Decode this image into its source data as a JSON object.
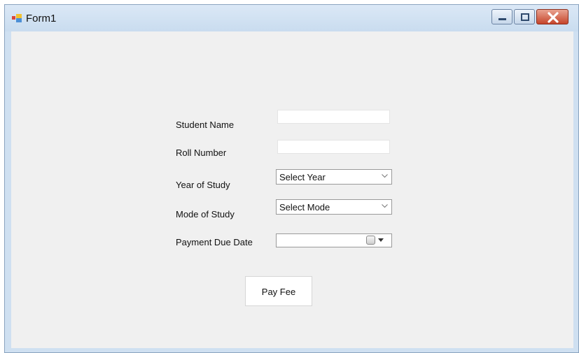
{
  "window": {
    "title": "Form1",
    "icon": "app-form-icon",
    "controls": {
      "minimize_icon": "minimize-icon",
      "maximize_icon": "maximize-icon",
      "close_icon": "close-icon"
    },
    "colors": {
      "titlebar": "#cfe0f1",
      "client": "#f0f0f0",
      "close_button": "#c6452b"
    }
  },
  "form": {
    "student_name": {
      "label": "Student Name",
      "value": ""
    },
    "roll_number": {
      "label": "Roll Number",
      "value": ""
    },
    "year_of_study": {
      "label": "Year of Study",
      "selected": "Select Year"
    },
    "mode_of_study": {
      "label": "Mode of Study",
      "selected": "Select Mode"
    },
    "payment_due_date": {
      "label": "Payment Due Date",
      "value": ""
    },
    "submit_label": "Pay Fee"
  }
}
